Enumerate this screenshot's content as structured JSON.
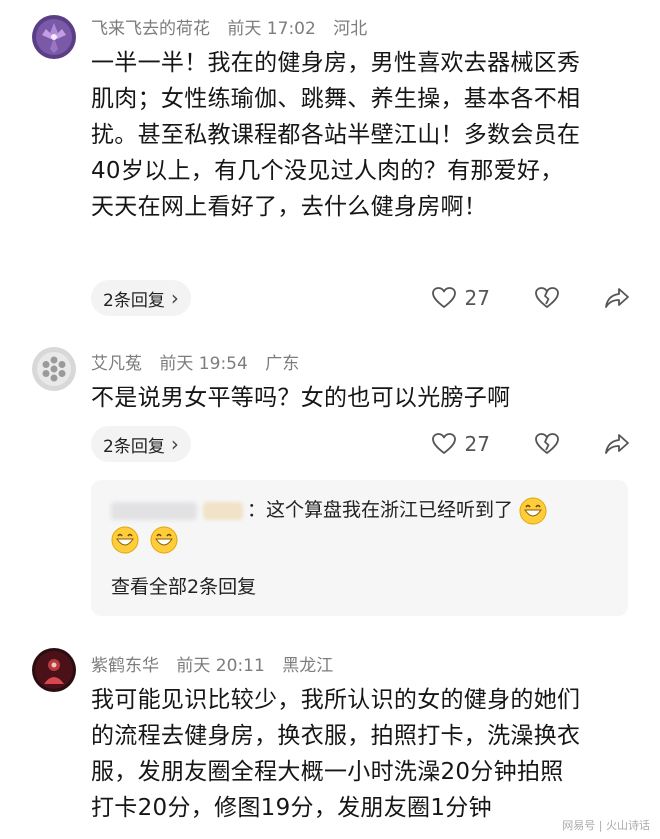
{
  "comments": [
    {
      "username": "飞来飞去的荷花",
      "time": "前天 17:02",
      "location": "河北",
      "lines": [
        "一半一半！我在的健身房，男性喜欢去器械区秀",
        "肌肉；女性练瑜伽、跳舞、养生操，基本各不相",
        "扰。甚至私教课程都各站半壁江山！多数会员在",
        "40岁以上，有几个没见过人肉的？有那爱好，",
        "天天在网上看好了，去什么健身房啊！"
      ],
      "reply_label": "2条回复",
      "likes": "27"
    },
    {
      "username": "艾凡菟",
      "time": "前天 19:54",
      "location": "广东",
      "lines": [
        "不是说男女平等吗？女的也可以光膀子啊"
      ],
      "reply_label": "2条回复",
      "likes": "27",
      "sub_reply": {
        "text": "：这个算盘我在浙江已经听到了",
        "more_label": "查看全部2条回复"
      }
    },
    {
      "username": "紫鹤东华",
      "time": "前天 20:11",
      "location": "黑龙江",
      "lines": [
        "我可能见识比较少，我所认识的女的健身的她们",
        "的流程去健身房，换衣服，拍照打卡，洗澡换衣",
        "服，发朋友圈全程大概一小时洗澡20分钟拍照",
        "打卡20分，修图19分，发朋友圈1分钟"
      ]
    }
  ],
  "icons": {
    "reply_chevron": "chevron-right-icon",
    "like": "heart-icon",
    "dislike": "broken-heart-icon",
    "share": "share-arrow-icon",
    "emoji": "grinning-face-emoji"
  },
  "watermark": "网易号 | 火山诗话",
  "colors": {
    "meta": "#7d7d7d",
    "text": "#161616",
    "pill_bg": "#f3f3f4",
    "subbox_bg": "#f6f6f7"
  }
}
